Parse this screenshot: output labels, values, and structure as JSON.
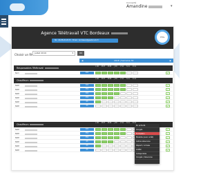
{
  "header": {
    "user_label": "Connecté",
    "user_name": "Amandine"
  },
  "card": {
    "agency_name": "Agence Télétravail VTC Bordeaux",
    "info_line": "Tel : 06.88.20.28.33  ·  Email : bordeaux@gestionvtc.fr",
    "progress_label": "75%"
  },
  "filters": {
    "period_label": "Choisir un RH",
    "period_value": "Juillet 2019",
    "ok_label": "OK"
  },
  "week": {
    "prev": "◀",
    "label": "2018  |  Semaine 32",
    "next": "▶"
  },
  "days": [
    "L 06",
    "M 07",
    "M 08",
    "J 09",
    "V 10",
    "S 11",
    "D 12"
  ],
  "sections": [
    {
      "title": "Responsables Télétravail",
      "total": "Total"
    },
    {
      "title": "Chauffeurs",
      "total": "Total"
    },
    {
      "title": "Chauffeurs",
      "total": "Total"
    }
  ],
  "rows_section1": [
    {
      "name": "Nom",
      "badge": "40h"
    }
  ],
  "rows_section2": [
    {
      "name": "NOM",
      "badge": "40h"
    },
    {
      "name": "NOM",
      "badge": "35h"
    },
    {
      "name": "NOM",
      "badge": "30h"
    },
    {
      "name": "NOM",
      "badge": "15h"
    },
    {
      "name": "NOM",
      "badge": "0h"
    },
    {
      "name": "NOM",
      "badge": "0h"
    }
  ],
  "rows_section3": [
    {
      "name": "NOM",
      "badge": "40h"
    },
    {
      "name": "NOM",
      "badge": "35h"
    },
    {
      "name": "NOM",
      "badge": "35h"
    },
    {
      "name": "NOM",
      "badge": "0h"
    },
    {
      "name": "NOM",
      "badge": "0h"
    },
    {
      "name": "NOM",
      "badge": "0h"
    }
  ],
  "context_menu": [
    "En activité",
    "Congés",
    "Formation",
    "Maladie (avec arrêt)",
    "Autres absences",
    "Départ / Arrivée",
    "Arrêté",
    "Indisponible",
    "Congés / Absences"
  ],
  "colors": {
    "dark": "#2d2d2d",
    "accent_blue": "#3b8fd6",
    "green": "#8fd16a",
    "menu_active": "#d94b4b"
  }
}
